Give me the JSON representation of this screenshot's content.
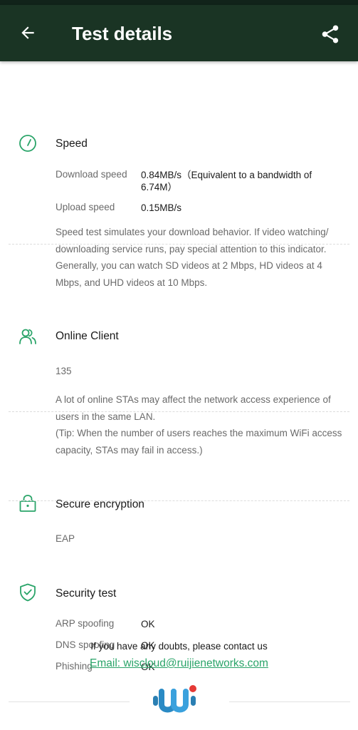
{
  "header": {
    "title": "Test details"
  },
  "icons": {
    "back": "arrow-back-icon",
    "share": "share-icon",
    "speed": "speedometer-icon",
    "client": "users-icon",
    "encryption": "lock-icon",
    "security": "shield-check-icon"
  },
  "colors": {
    "appbar": "#1a3424",
    "accent": "#2aa469",
    "logo_blue": "#2a7fb3",
    "logo_red": "#e53935"
  },
  "speed": {
    "title": "Speed",
    "download_label": "Download speed",
    "download_value": "0.84MB/s（Equivalent to a bandwidth of 6.74M）",
    "upload_label": "Upload speed",
    "upload_value": "0.15MB/s",
    "description": "Speed test simulates your download behavior. If video watching/ downloading service runs, pay special attention to this indicator. Generally, you can watch SD videos at 2 Mbps, HD videos at 4 Mbps, and UHD videos at 10 Mbps."
  },
  "online_client": {
    "title": "Online Client",
    "count": "135",
    "description": "A lot of online STAs may affect the network access experience of users in the same LAN.",
    "tip": "(Tip: When the number of users reaches the maximum WiFi access capacity, STAs may fail in access.)"
  },
  "secure_encryption": {
    "title": "Secure encryption",
    "value": "EAP"
  },
  "security_test": {
    "title": "Security test",
    "rows": [
      {
        "label": "ARP spoofing",
        "value": "OK"
      },
      {
        "label": "DNS spoofing",
        "value": "OK"
      },
      {
        "label": "Phishing",
        "value": "OK"
      }
    ]
  },
  "footer": {
    "contact_text": "If you have any doubts, please contact us",
    "email_text": "Email: wiscloud@ruijienetworks.com"
  }
}
